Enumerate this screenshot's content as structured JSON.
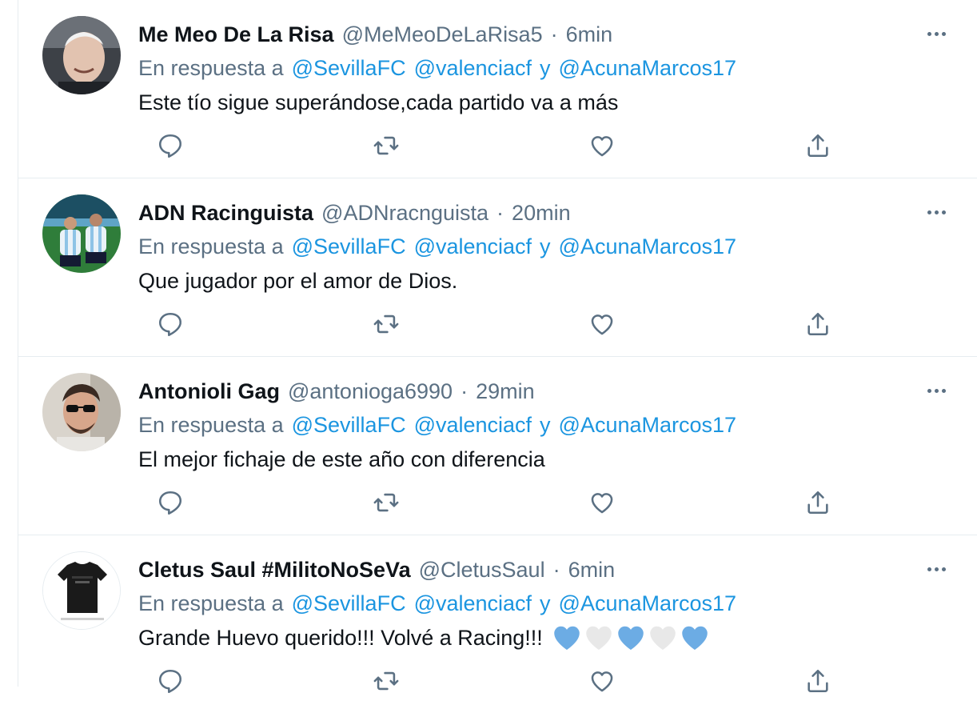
{
  "tweets": [
    {
      "name": "Me Meo De La Risa",
      "handle": "@MeMeoDeLaRisa5",
      "separator": "·",
      "time": "6min",
      "reply_prefix": "En respuesta a",
      "mentions": [
        "@SevillaFC",
        "@valenciacf"
      ],
      "conjunction": "y",
      "last_mention": "@AcunaMarcos17",
      "text": "Este tío sigue superándose,cada partido va a más",
      "avatar": "avatar-older-man"
    },
    {
      "name": "ADN Racinguista",
      "handle": "@ADNracnguista",
      "separator": "·",
      "time": "20min",
      "reply_prefix": "En respuesta a",
      "mentions": [
        "@SevillaFC",
        "@valenciacf"
      ],
      "conjunction": "y",
      "last_mention": "@AcunaMarcos17",
      "text": "Que jugador por el amor de Dios.",
      "avatar": "avatar-footballers"
    },
    {
      "name": "Antonioli Gag",
      "handle": "@antonioga6990",
      "separator": "·",
      "time": "29min",
      "reply_prefix": "En respuesta a",
      "mentions": [
        "@SevillaFC",
        "@valenciacf"
      ],
      "conjunction": "y",
      "last_mention": "@AcunaMarcos17",
      "text": "El mejor fichaje de este año con diferencia",
      "avatar": "avatar-man-sunglasses"
    },
    {
      "name": "Cletus Saul #MilitoNoSeVa",
      "handle": "@CletusSaul",
      "separator": "·",
      "time": "6min",
      "reply_prefix": "En respuesta a",
      "mentions": [
        "@SevillaFC",
        "@valenciacf"
      ],
      "conjunction": "y",
      "last_mention": "@AcunaMarcos17",
      "text": "Grande Huevo querido!!! Volvé a Racing!!!",
      "avatar": "avatar-black-shirt",
      "emoji_hearts": [
        "blue-heart",
        "white-heart",
        "blue-heart",
        "white-heart",
        "blue-heart"
      ]
    }
  ],
  "icons": {
    "more": "more-dots-icon",
    "reply": "reply-icon",
    "retweet": "retweet-icon",
    "like": "like-icon",
    "share": "share-icon"
  },
  "colors": {
    "link": "#1b95e0",
    "secondary_text": "#5b7083",
    "primary_text": "#0f1419",
    "heart_blue": "#6cace4",
    "heart_white": "#e8e8e8"
  }
}
